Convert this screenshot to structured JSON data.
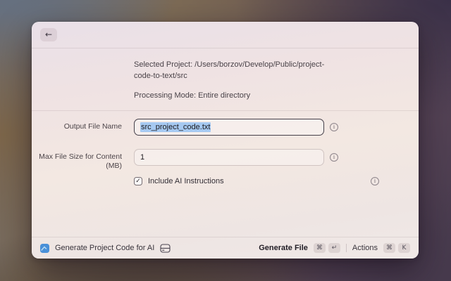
{
  "window": {
    "header": {
      "back_icon": "←"
    },
    "details": {
      "selected_project": "Selected Project: /Users/borzov/Develop/Public/project-code-to-text/src",
      "processing_mode": "Processing Mode: Entire directory"
    },
    "form": {
      "output_file": {
        "label": "Output File Name",
        "value": "src_project_code.txt"
      },
      "max_size": {
        "label": "Max File Size for Content (MB)",
        "value": "1"
      },
      "ai_instructions": {
        "label": "Include AI Instructions",
        "checked": true,
        "check_glyph": "✓"
      },
      "info_icon_glyph": "i"
    },
    "footer": {
      "app_name": "Generate Project Code for AI",
      "primary_action": {
        "label": "Generate File",
        "keys": [
          "⌘",
          "↵"
        ]
      },
      "actions_menu": {
        "label": "Actions",
        "keys": [
          "⌘",
          "K"
        ]
      }
    }
  },
  "colors": {
    "selection_highlight": "#a6c9f1",
    "app_icon_blue": "#4a90d8",
    "focused_border": "#45404a",
    "window_tint": "#f0e4e1"
  }
}
